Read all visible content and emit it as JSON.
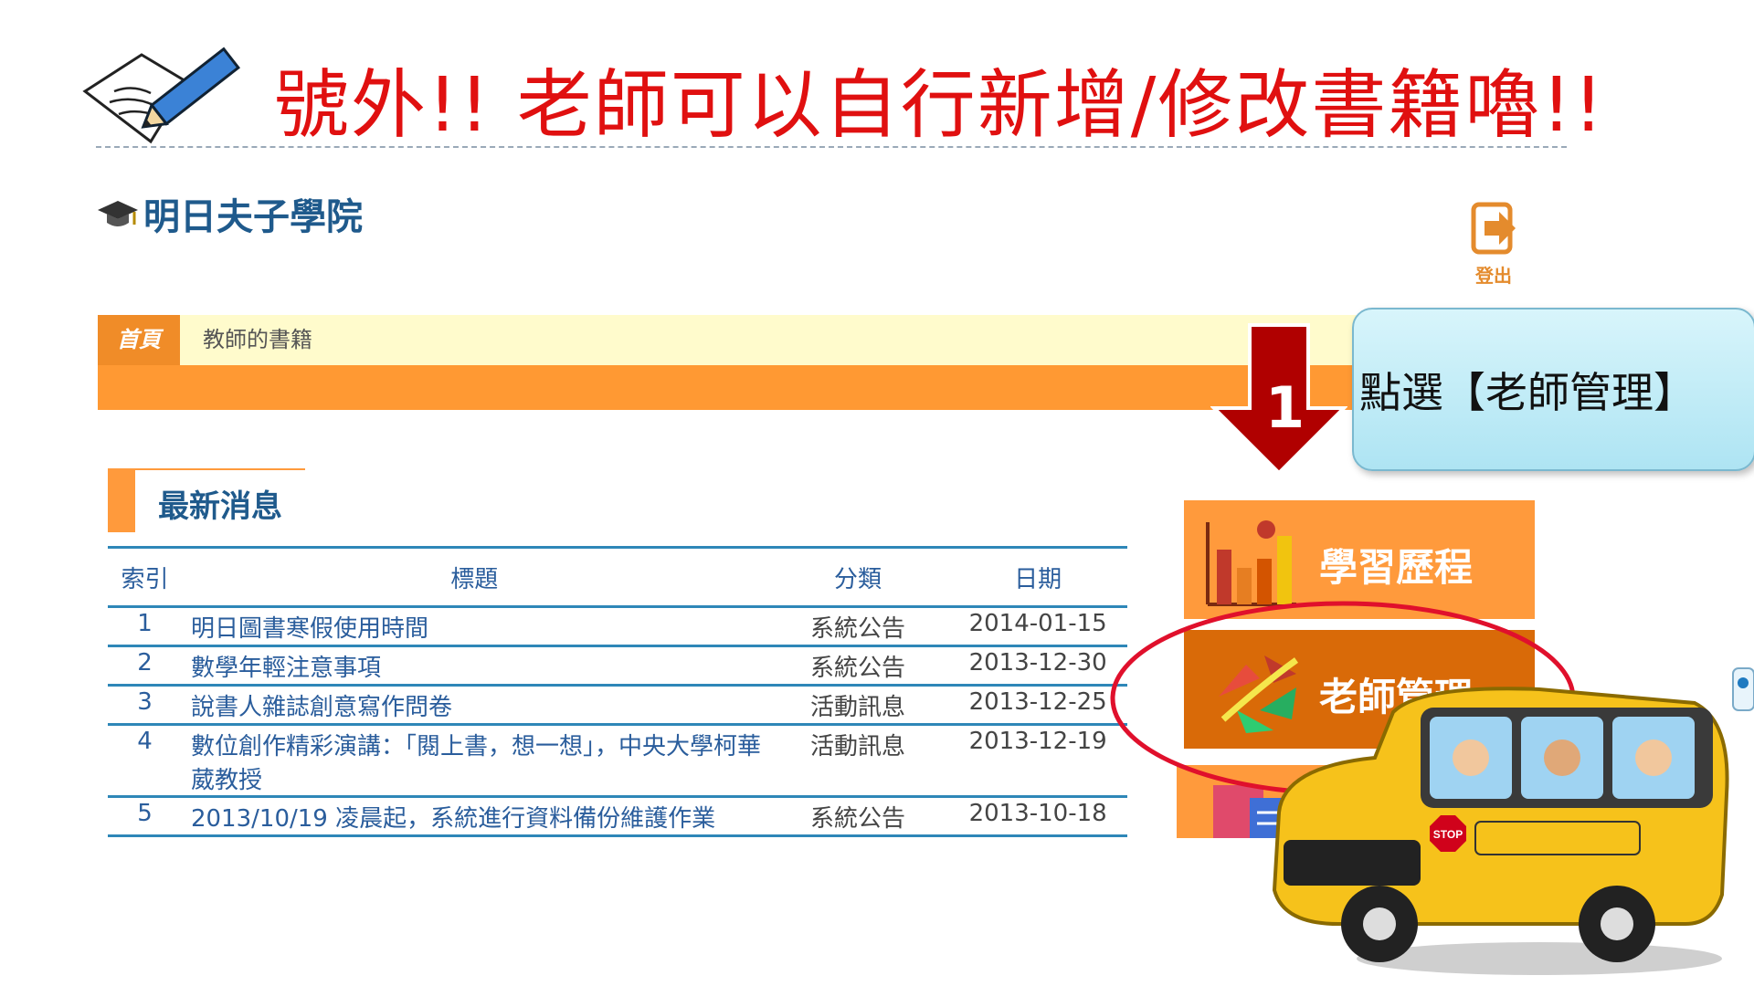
{
  "slide": {
    "title": "號外!!  老師可以自行新增/修改書籍嚕!!"
  },
  "header": {
    "school_name": "明日夫子學院",
    "logout_label": "登出"
  },
  "nav": {
    "home_label": "首頁",
    "books_label": "教師的書籍"
  },
  "news": {
    "heading": "最新消息",
    "columns": {
      "index": "索引",
      "title": "標題",
      "category": "分類",
      "date": "日期"
    },
    "rows": [
      {
        "index": "1",
        "title": "明日圖書寒假使用時間",
        "category": "系統公告",
        "date": "2014-01-15"
      },
      {
        "index": "2",
        "title": "數學年輕注意事項",
        "category": "系統公告",
        "date": "2013-12-30"
      },
      {
        "index": "3",
        "title": "說書人雜誌創意寫作問卷",
        "category": "活動訊息",
        "date": "2013-12-25"
      },
      {
        "index": "4",
        "title": "數位創作精彩演講：「閱上書，想一想」，中央大學柯華葳教授",
        "category": "活動訊息",
        "date": "2013-12-19"
      },
      {
        "index": "5",
        "title": "2013/10/19 凌晨起，系統進行資料備份維護作業",
        "category": "系統公告",
        "date": "2013-10-18"
      }
    ]
  },
  "menu": {
    "learning_label": "學習歷程",
    "teacher_label": "老師管理"
  },
  "callout": {
    "text": "點選【老師管理】",
    "step_number": "1"
  },
  "colors": {
    "title_red": "#e01010",
    "orange": "#ff9933",
    "dark_orange": "#d96a08",
    "blue_text": "#2a5d9c"
  }
}
